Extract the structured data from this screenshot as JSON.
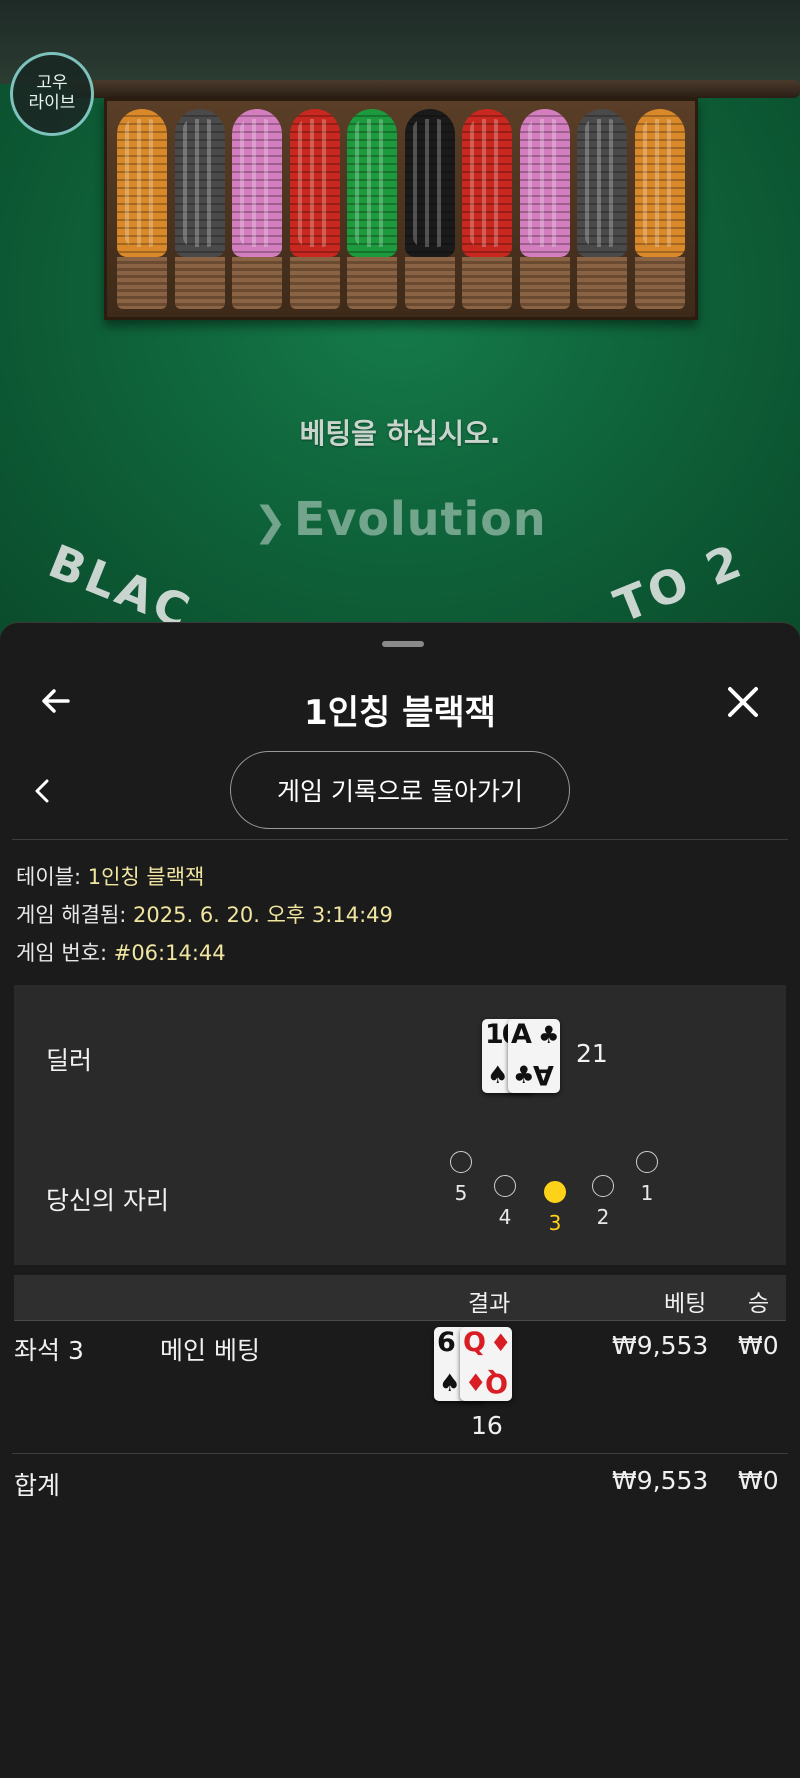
{
  "brand": {
    "line1": "고우",
    "line2": "라이브"
  },
  "table_view": {
    "message": "베팅을 하십시오.",
    "logo_text": "Evolution",
    "arc_left": "BLAC",
    "arc_right": "TO 2"
  },
  "chip_colors": [
    "#d9892a",
    "#4a4a4a",
    "#d37fbf",
    "#c8281f",
    "#1e9a3e",
    "#1a1a1a",
    "#c8281f",
    "#d37fbf",
    "#4a4a4a",
    "#d9892a"
  ],
  "sheet": {
    "title": "1인칭 블랙잭",
    "back_to_history_label": "게임 기록으로 돌아가기"
  },
  "info": {
    "table_label": "테이블: ",
    "table_value": "1인칭 블랙잭",
    "resolved_label": "게임 해결됨: ",
    "resolved_value": "2025. 6. 20. 오후 3:14:49",
    "game_no_label": "게임 번호: ",
    "game_no_value": "#06:14:44"
  },
  "dealer": {
    "label": "딜러",
    "cards": [
      {
        "rank": "10",
        "suit": "♠",
        "color": "black"
      },
      {
        "rank": "A",
        "suit": "♣",
        "color": "black"
      }
    ],
    "score": "21"
  },
  "seats": {
    "label": "당신의 자리",
    "list": [
      {
        "num": "5",
        "active": false
      },
      {
        "num": "4",
        "active": false
      },
      {
        "num": "3",
        "active": true
      },
      {
        "num": "2",
        "active": false
      },
      {
        "num": "1",
        "active": false
      }
    ]
  },
  "results_table": {
    "headers": {
      "result": "결과",
      "bet": "베팅",
      "win": "승"
    },
    "row": {
      "seat": "좌석 3",
      "bet_type": "메인 베팅",
      "cards": [
        {
          "rank": "6",
          "suit": "♠",
          "color": "black"
        },
        {
          "rank": "Q",
          "suit": "♦",
          "color": "red"
        }
      ],
      "score": "16",
      "bet": "₩9,553",
      "win": "₩0"
    },
    "total": {
      "label": "합계",
      "bet": "₩9,553",
      "win": "₩0"
    }
  }
}
